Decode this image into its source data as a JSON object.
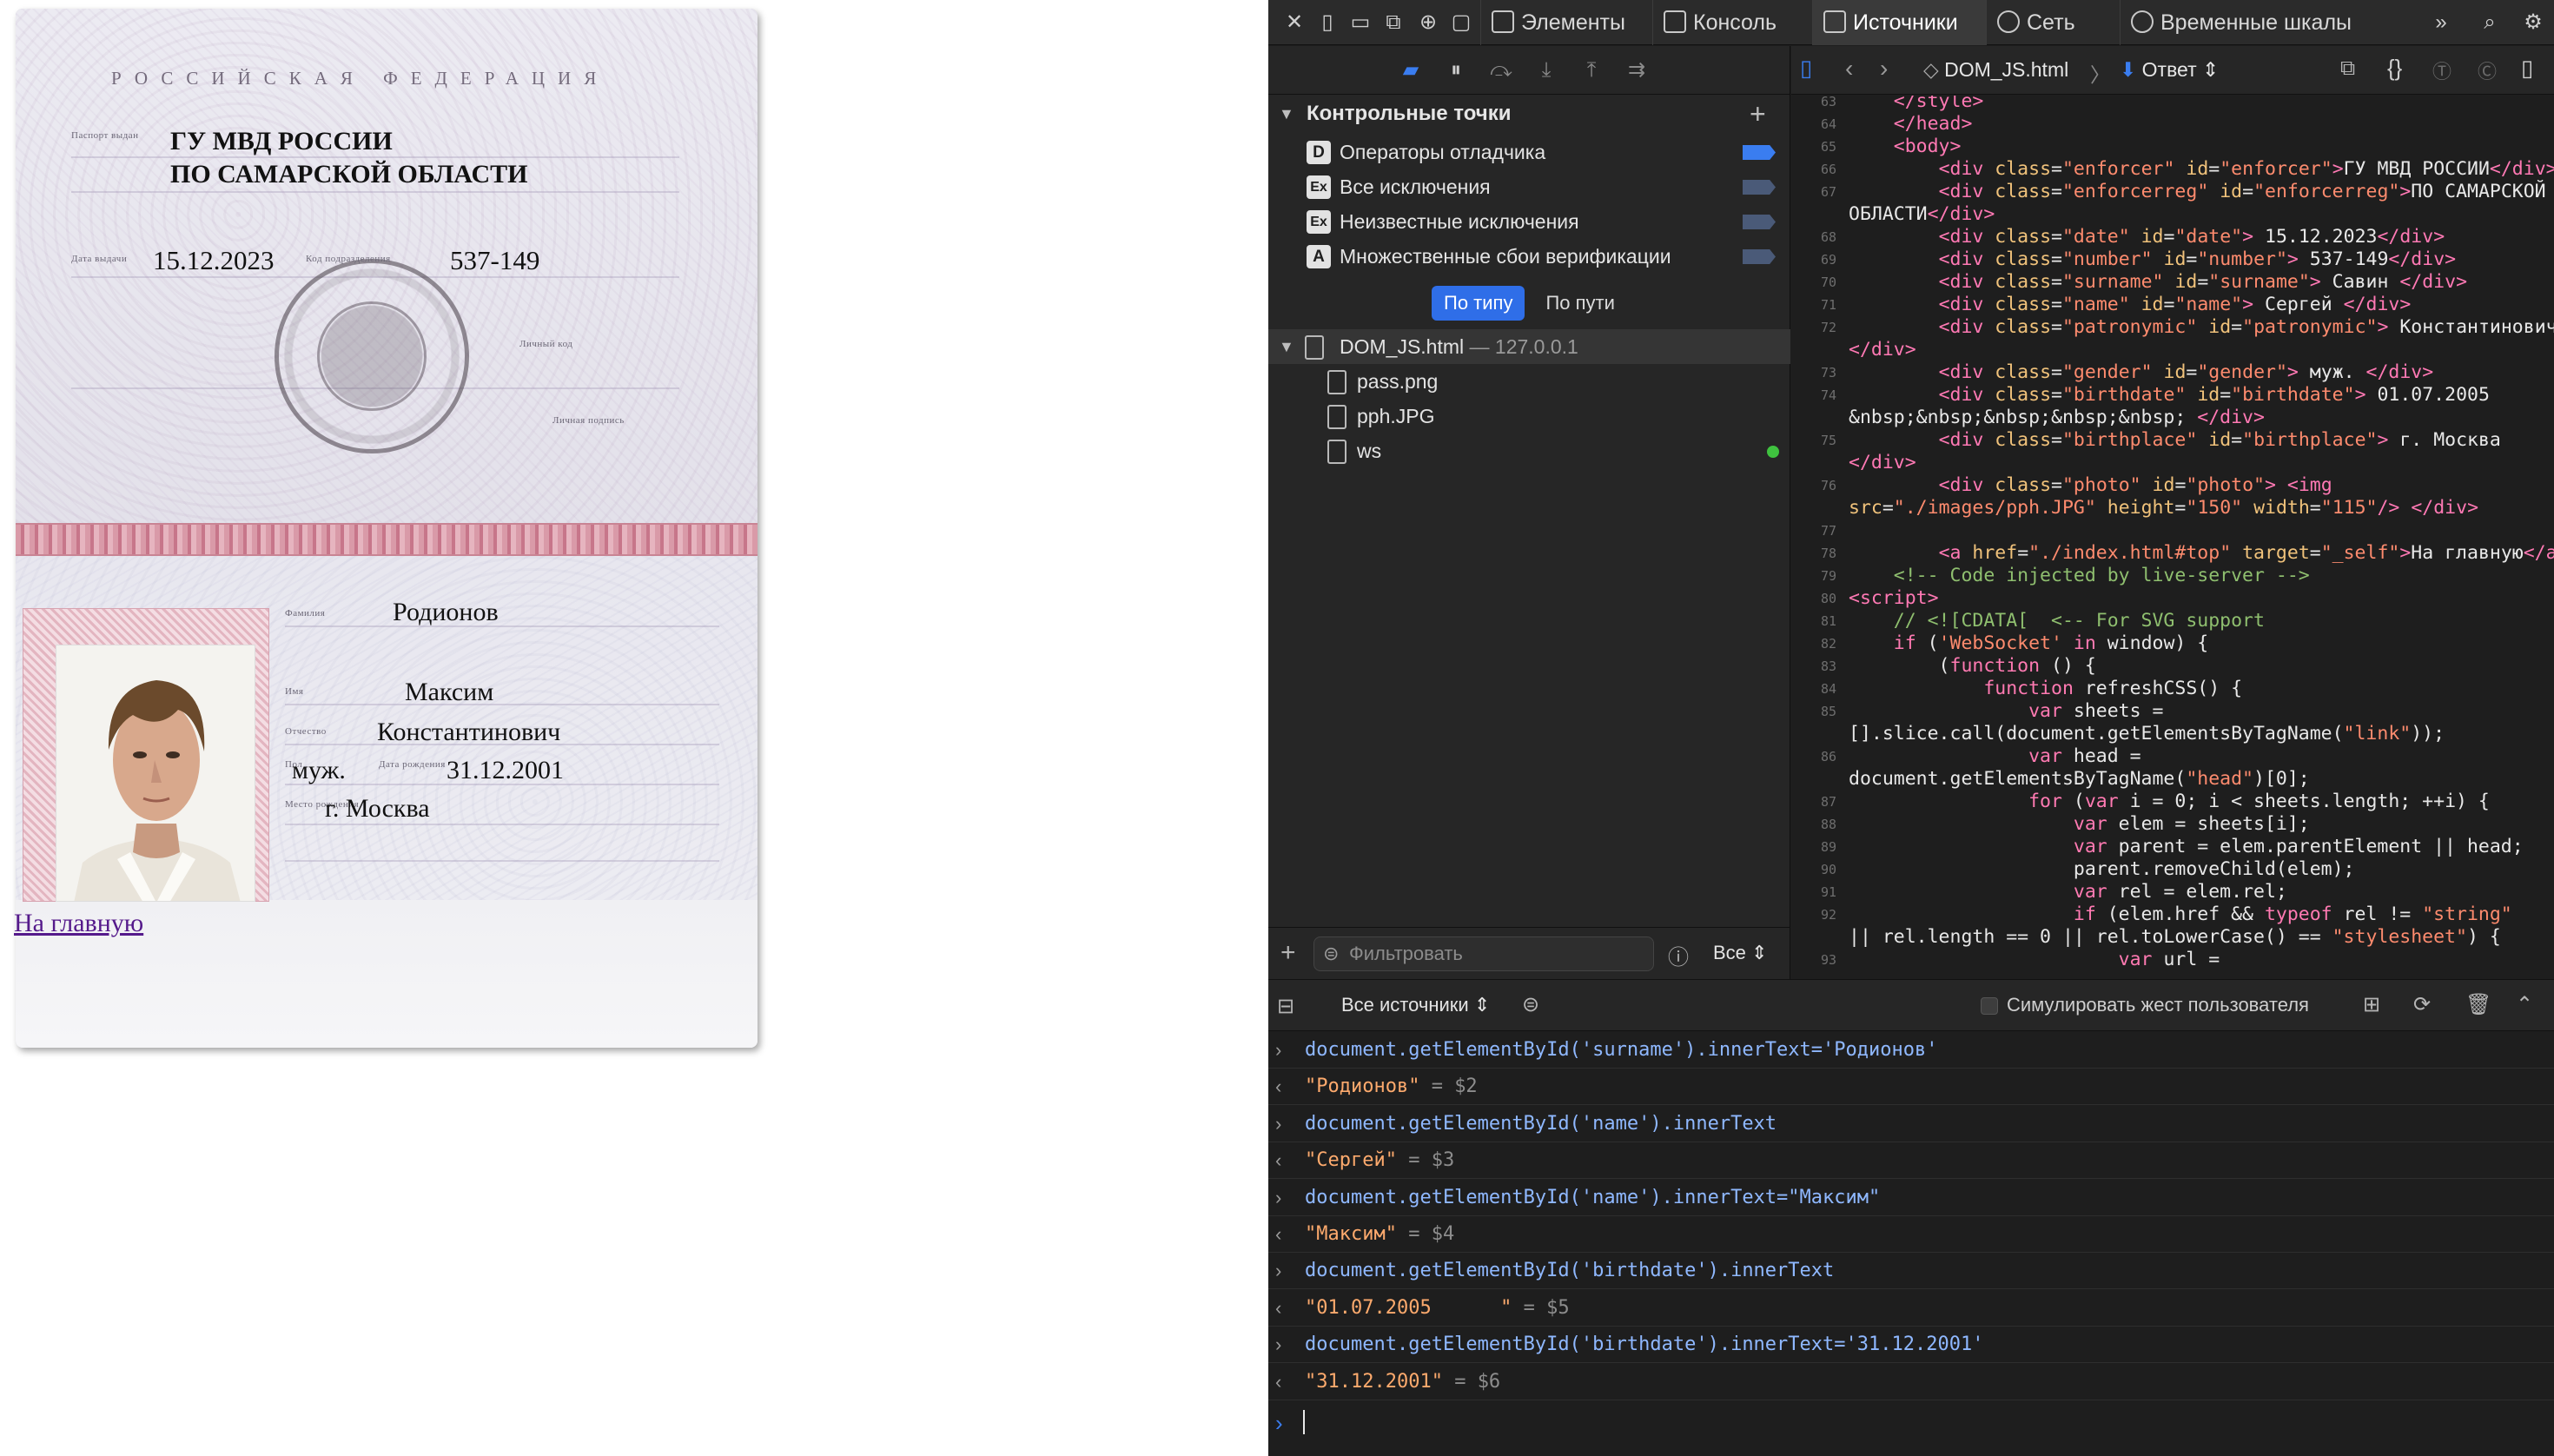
{
  "passport": {
    "header": "РОССИЙСКАЯ ФЕДЕРАЦИЯ",
    "enforcer": "ГУ МВД РОССИИ",
    "enforcerreg": "ПО САМАРСКОЙ ОБЛАСТИ",
    "date": "15.12.2023",
    "number": "537-149",
    "surname": "Родионов",
    "name": "Максим",
    "patronymic": "Константинович",
    "gender": "муж.",
    "birthdate": "31.12.2001",
    "birthplace": "г. Москва",
    "labels": {
      "issued_by": "Паспорт выдан",
      "issue_date": "Дата выдачи",
      "dept_code": "Код подразделения",
      "personal_code": "Личный код",
      "signature": "Личная подпись",
      "surname": "Фамилия",
      "name": "Имя",
      "patronymic": "Отчество",
      "gender": "Пол",
      "birth_date": "Дата рождения",
      "birth_place": "Место рождения"
    }
  },
  "home_link": "На главную",
  "devtools": {
    "tabs": [
      "Элементы",
      "Консоль",
      "Источники",
      "Сеть",
      "Временные шкалы"
    ],
    "active_tab": "Источники",
    "breakpoints": {
      "title": "Контрольные точки",
      "items": [
        {
          "badge": "D",
          "label": "Операторы отладчика"
        },
        {
          "badge": "Ex",
          "label": "Все исключения"
        },
        {
          "badge": "Ex",
          "label": "Неизвестные исключения"
        },
        {
          "badge": "A",
          "label": "Множественные сбои верификации"
        }
      ]
    },
    "segments": [
      "По типу",
      "По пути"
    ],
    "tree": {
      "root": "DOM_JS.html",
      "root_host": "— 127.0.0.1",
      "files": [
        "pass.png",
        "pph.JPG",
        "ws"
      ]
    },
    "filter_placeholder": "Фильтровать",
    "filter_all": "Все",
    "breadcrumb": {
      "file": "DOM_JS.html",
      "response": "Ответ"
    },
    "accent": "#2f6ee8",
    "code_lines": [
      {
        "n": "63",
        "t": "    </style>"
      },
      {
        "n": "64",
        "t": "    </head>"
      },
      {
        "n": "65",
        "t": "    <body>"
      },
      {
        "n": "66",
        "t": "        <div class=\"enforcer\" id=\"enforcer\">ГУ МВД РОССИИ</div>"
      },
      {
        "n": "67",
        "t": "        <div class=\"enforcerreg\" id=\"enforcerreg\">ПО САМАРСКОЙ"
      },
      {
        "n": "",
        "t": "ОБЛАСТИ</div>"
      },
      {
        "n": "68",
        "t": "        <div class=\"date\" id=\"date\"> 15.12.2023</div>"
      },
      {
        "n": "69",
        "t": "        <div class=\"number\" id=\"number\"> 537-149</div>"
      },
      {
        "n": "70",
        "t": "        <div class=\"surname\" id=\"surname\"> Савин </div>"
      },
      {
        "n": "71",
        "t": "        <div class=\"name\" id=\"name\"> Сергей </div>"
      },
      {
        "n": "72",
        "t": "        <div class=\"patronymic\" id=\"patronymic\"> Константинович"
      },
      {
        "n": "",
        "t": "</div>"
      },
      {
        "n": "73",
        "t": "        <div class=\"gender\" id=\"gender\"> муж. </div>"
      },
      {
        "n": "74",
        "t": "        <div class=\"birthdate\" id=\"birthdate\"> 01.07.2005"
      },
      {
        "n": "",
        "t": "&nbsp;&nbsp;&nbsp;&nbsp;&nbsp; </div>"
      },
      {
        "n": "75",
        "t": "        <div class=\"birthplace\" id=\"birthplace\"> г. Москва"
      },
      {
        "n": "",
        "t": "</div>"
      },
      {
        "n": "76",
        "t": "        <div class=\"photo\" id=\"photo\"> <img"
      },
      {
        "n": "",
        "t": "src=\"./images/pph.JPG\" height=\"150\" width=\"115\"/> </div>"
      },
      {
        "n": "77",
        "t": ""
      },
      {
        "n": "78",
        "t": "        <a href=\"./index.html#top\" target=\"_self\">На главную</a>"
      },
      {
        "n": "79",
        "t": "    <!-- Code injected by live-server -->"
      },
      {
        "n": "80",
        "t": "<script>"
      },
      {
        "n": "81",
        "t": "    // <![CDATA[  <-- For SVG support"
      },
      {
        "n": "82",
        "t": "    if ('WebSocket' in window) {"
      },
      {
        "n": "83",
        "t": "        (function () {"
      },
      {
        "n": "84",
        "t": "            function refreshCSS() {"
      },
      {
        "n": "85",
        "t": "                var sheets ="
      },
      {
        "n": "",
        "t": "[].slice.call(document.getElementsByTagName(\"link\"));"
      },
      {
        "n": "86",
        "t": "                var head ="
      },
      {
        "n": "",
        "t": "document.getElementsByTagName(\"head\")[0];"
      },
      {
        "n": "87",
        "t": "                for (var i = 0; i < sheets.length; ++i) {"
      },
      {
        "n": "88",
        "t": "                    var elem = sheets[i];"
      },
      {
        "n": "89",
        "t": "                    var parent = elem.parentElement || head;"
      },
      {
        "n": "90",
        "t": "                    parent.removeChild(elem);"
      },
      {
        "n": "91",
        "t": "                    var rel = elem.rel;"
      },
      {
        "n": "92",
        "t": "                    if (elem.href && typeof rel != \"string\""
      },
      {
        "n": "",
        "t": "|| rel.length == 0 || rel.toLowerCase() == \"stylesheet\") {"
      },
      {
        "n": "93",
        "t": "                        var url ="
      }
    ],
    "console_filter": "Все источники",
    "simulate_gesture": "Симулировать жест пользователя",
    "console": [
      {
        "kind": "in",
        "text": "document.getElementById('surname').innerText='Родионов'"
      },
      {
        "kind": "out",
        "text": "\"Родионов\"",
        "ref": " = $2"
      },
      {
        "kind": "in",
        "text": "document.getElementById('name').innerText"
      },
      {
        "kind": "out",
        "text": "\"Сергей\"",
        "ref": " = $3"
      },
      {
        "kind": "in",
        "text": "document.getElementById('name').innerText=\"Максим\""
      },
      {
        "kind": "out",
        "text": "\"Максим\"",
        "ref": " = $4"
      },
      {
        "kind": "in",
        "text": "document.getElementById('birthdate').innerText"
      },
      {
        "kind": "out",
        "text": "\"01.07.2005      \"",
        "ref": " = $5"
      },
      {
        "kind": "in",
        "text": "document.getElementById('birthdate').innerText='31.12.2001'"
      },
      {
        "kind": "out",
        "text": "\"31.12.2001\"",
        "ref": " = $6"
      }
    ]
  }
}
